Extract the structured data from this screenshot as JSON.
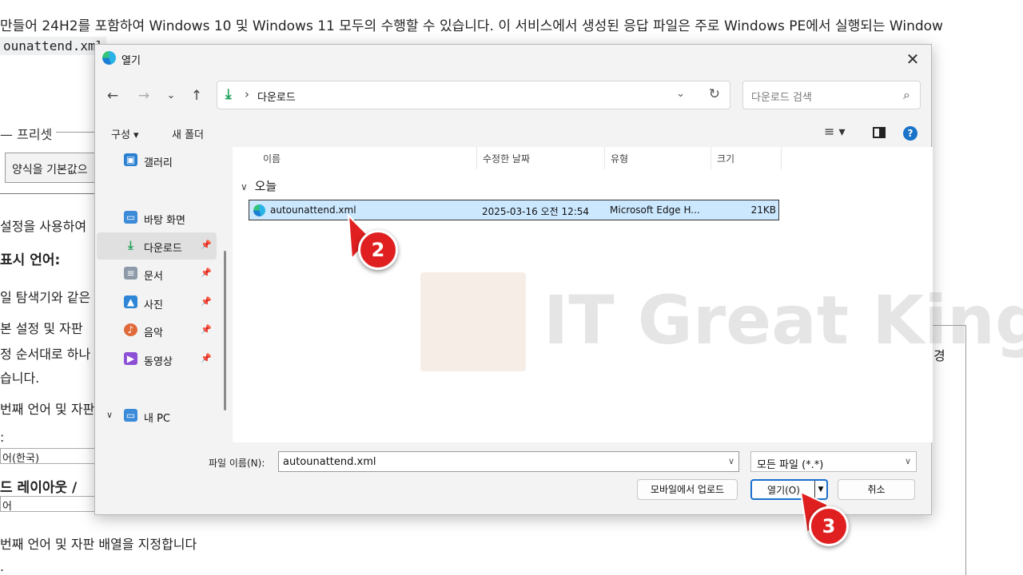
{
  "background": {
    "line1": "만들어 24H2를 포함하여 Windows 10 및 Windows 11 모두의 수행할 수 있습니다. 이 서비스에서 생성된 응답 파일은 주로 Windows PE에서 실행되는 Window",
    "code": "ounattend.xml",
    "legend": "프리셋",
    "select_value": "양식을 기본값으",
    "text_settings": "설정을 사용하여",
    "text_display_lang": "표시 언어:",
    "text_explorer": "일 탐색기와 같은",
    "text_basic": "본 설정 및 자판",
    "text_order": "정 순서대로 하나",
    "text_end": "습니다.",
    "text_first_lang": "번째 언어 및 자판",
    "text_colon": ":",
    "input_korean": "어(한국)",
    "text_keyboard": "드 레이아웃 /",
    "input_lang": "어",
    "text_specify": "번째 언어 및 자판 배열을 지정합니다",
    "text_dot": ".",
    "right_char": "경"
  },
  "dialog": {
    "title": "열기",
    "close": "✕",
    "nav": {
      "back": "←",
      "forward": "→",
      "dropdown": "⌄",
      "up": "↑"
    },
    "address": {
      "icon": "download-icon",
      "separator": "›",
      "path": "다운로드",
      "chevron": "⌄",
      "refresh": "↻"
    },
    "search_placeholder": "다운로드 검색",
    "toolbar": {
      "organize": "구성 ▾",
      "new_folder": "새 폴더",
      "view": "≡ ▾",
      "help": "?"
    },
    "sidebar": [
      {
        "label": "갤러리",
        "icon": "gallery-icon",
        "color": "#2a7fd0",
        "pinned": false
      },
      {
        "label": "바탕 화면",
        "icon": "desktop-icon",
        "color": "#3b8bd8",
        "pinned": true
      },
      {
        "label": "다운로드",
        "icon": "download-icon",
        "color": "#1fa05a",
        "pinned": true
      },
      {
        "label": "문서",
        "icon": "document-icon",
        "color": "#8d9aa8",
        "pinned": true
      },
      {
        "label": "사진",
        "icon": "pictures-icon",
        "color": "#2f86d6",
        "pinned": true
      },
      {
        "label": "음악",
        "icon": "music-icon",
        "color": "#e06a3a",
        "pinned": true
      },
      {
        "label": "동영상",
        "icon": "videos-icon",
        "color": "#8c4fd6",
        "pinned": true
      },
      {
        "label": "내 PC",
        "icon": "pc-icon",
        "color": "#3b8bd8",
        "pinned": false
      }
    ],
    "pin_glyph": "📌",
    "columns": [
      "이름",
      "수정한 날짜",
      "유형",
      "크기"
    ],
    "group_label": "오늘",
    "files": [
      {
        "name": "autounattend.xml",
        "date": "2025-03-16 오전 12:54",
        "type": "Microsoft Edge H...",
        "size": "21KB"
      }
    ],
    "filename_label": "파일 이름(N):",
    "filename_value": "autounattend.xml",
    "filter_value": "모든 파일 (*.*)",
    "buttons": {
      "upload": "모바일에서 업로드",
      "open": "열기(O)",
      "cancel": "취소"
    }
  },
  "watermark": "IT Great King",
  "annotations": [
    "2",
    "3"
  ],
  "colors": {
    "selection": "#cce8ff",
    "badge": "#e02020",
    "accent": "#1a6fcf"
  }
}
